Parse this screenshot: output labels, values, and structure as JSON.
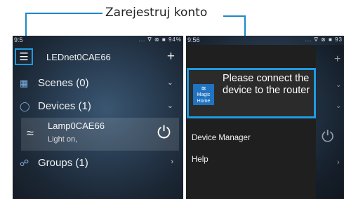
{
  "caption": "Zarejestruj konto",
  "left_screen": {
    "status_time": "9:5",
    "status_icons": "... ∇ ⊗ ■ 94%",
    "title": "LEDnet0CAE66",
    "scenes": "Scenes (0)",
    "devices": "Devices (1)",
    "device_name": "Lamp0CAE66",
    "device_status": "Light on,",
    "groups": "Groups (1)"
  },
  "right_screen": {
    "status_time": "9:56",
    "status_icons": "... ∇ ⊗ ■ 93",
    "logo_text_1": "Magic",
    "logo_text_2": "Home",
    "message": "Please connect the device to the router",
    "menu_items": [
      "Device Manager",
      "Help"
    ]
  }
}
